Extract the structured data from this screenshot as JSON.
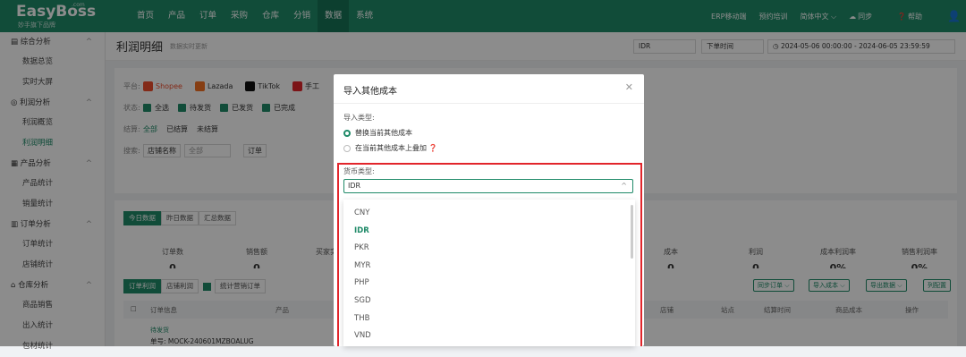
{
  "brand": {
    "name": "EasyBoss",
    "sub": "妙手旗下品牌",
    "com": ".com"
  },
  "nav": [
    "首页",
    "产品",
    "订单",
    "采购",
    "仓库",
    "分销",
    "数据",
    "系统"
  ],
  "nav_active": 6,
  "topright": [
    "ERP移动端",
    "预约培训",
    "简体中文 ⌵",
    "同步",
    "帮助"
  ],
  "sidebar": [
    {
      "type": "group",
      "label": "综合分析"
    },
    {
      "type": "item",
      "label": "数据总览"
    },
    {
      "type": "item",
      "label": "实时大屏"
    },
    {
      "type": "group",
      "label": "利润分析"
    },
    {
      "type": "item",
      "label": "利润概览"
    },
    {
      "type": "item",
      "label": "利润明细",
      "active": true
    },
    {
      "type": "group",
      "label": "产品分析"
    },
    {
      "type": "item",
      "label": "产品统计"
    },
    {
      "type": "item",
      "label": "销量统计"
    },
    {
      "type": "group",
      "label": "订单分析"
    },
    {
      "type": "item",
      "label": "订单统计"
    },
    {
      "type": "item",
      "label": "店铺统计"
    },
    {
      "type": "group",
      "label": "仓库分析"
    },
    {
      "type": "item",
      "label": "商品销售"
    },
    {
      "type": "item",
      "label": "出入统计"
    },
    {
      "type": "item",
      "label": "包材统计"
    }
  ],
  "page": {
    "title": "利润明细",
    "subtitle": "数据实时更新"
  },
  "header_controls": {
    "currency": "IDR",
    "time_type": "下单时间",
    "date_start": "2024-05-06 00:00:00",
    "date_end": "2024-06-05 23:59:59"
  },
  "filters": {
    "platform_label": "平台:",
    "platforms": [
      {
        "name": "Shopee",
        "color": "#ee4d2d"
      },
      {
        "name": "Lazada",
        "color": "#f57224"
      },
      {
        "name": "TikTok",
        "color": "#111111"
      },
      {
        "name": "手工",
        "color": "#e2252b"
      }
    ],
    "status_label": "状态:",
    "statuses": [
      "全选",
      "待发货",
      "已发货",
      "已完成"
    ],
    "settle_label": "结算:",
    "settles": [
      "全部",
      "已结算",
      "未结算"
    ],
    "search_label": "搜索:",
    "search_field": "店铺名称",
    "search_scope": "全部",
    "order_prefix": "订单"
  },
  "range_tabs": [
    "今日数据",
    "昨日数据",
    "汇总数据"
  ],
  "stats": [
    {
      "label": "订单数",
      "value": "0"
    },
    {
      "label": "销售额",
      "value": "0"
    },
    {
      "label": "买家实",
      "value": ""
    },
    {
      "label": "成本",
      "value": "0"
    },
    {
      "label": "利润",
      "value": "0"
    },
    {
      "label": "成本利润率",
      "value": "0%"
    },
    {
      "label": "销售利润率",
      "value": "0%"
    }
  ],
  "table": {
    "tabs": [
      "订单利润",
      "店铺利润"
    ],
    "checkbox_label": "统计营销订单",
    "buttons": [
      "同步订单 ⌵",
      "导入成本 ⌵",
      "导出数据 ⌵",
      "列配置"
    ],
    "headers": [
      "订单信息",
      "产品",
      "店铺",
      "站点",
      "结算时间",
      "商品成本",
      "操作"
    ],
    "row_status": "待发货",
    "row_order": "单号: MOCK-240601MZBOALUG"
  },
  "modal": {
    "title": "导入其他成本",
    "import_type_label": "导入类型:",
    "options": [
      "替换当前其他成本",
      "在当前其他成本上叠加"
    ],
    "currency_label": "货币类型:",
    "currency_value": "IDR",
    "currency_options": [
      "CNY",
      "IDR",
      "PKR",
      "MYR",
      "PHP",
      "SGD",
      "THB",
      "VND"
    ],
    "selected_currency": "IDR"
  }
}
